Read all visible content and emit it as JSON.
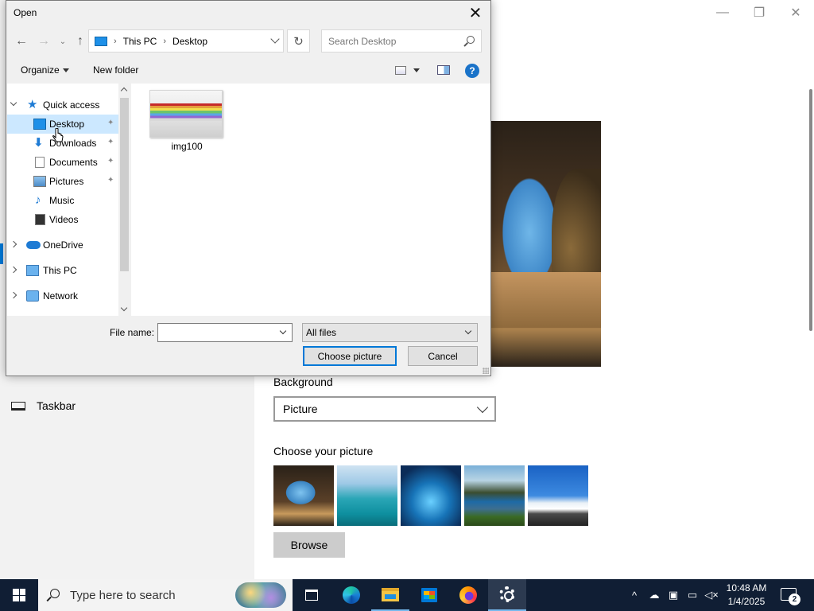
{
  "settings": {
    "window_controls": {
      "minimize": "—",
      "maximize": "❐",
      "close": "✕"
    },
    "nav_taskbar_label": "Taskbar",
    "background_label": "Background",
    "background_value": "Picture",
    "choose_picture_label": "Choose your picture",
    "browse_label": "Browse"
  },
  "dialog": {
    "title": "Open",
    "close_glyph": "✕",
    "nav": {
      "back": "←",
      "forward": "→",
      "recent": "⌄",
      "up": "↑",
      "refresh": "↻"
    },
    "breadcrumb": [
      "This PC",
      "Desktop"
    ],
    "breadcrumb_sep": "›",
    "search_placeholder": "Search Desktop",
    "toolbar": {
      "organize": "Organize",
      "new_folder": "New folder",
      "help": "?"
    },
    "nav_tree": [
      {
        "label": "Quick access",
        "icon": "star-icon"
      },
      {
        "label": "Desktop",
        "icon": "desktop-icon",
        "pinned": true,
        "selected": true
      },
      {
        "label": "Downloads",
        "icon": "download-icon",
        "pinned": true
      },
      {
        "label": "Documents",
        "icon": "document-icon",
        "pinned": true
      },
      {
        "label": "Pictures",
        "icon": "pictures-icon",
        "pinned": true
      },
      {
        "label": "Music",
        "icon": "music-icon"
      },
      {
        "label": "Videos",
        "icon": "video-icon"
      },
      {
        "label": "OneDrive",
        "icon": "cloud-icon"
      },
      {
        "label": "This PC",
        "icon": "computer-icon"
      },
      {
        "label": "Network",
        "icon": "network-icon"
      }
    ],
    "pin_glyph": "📌",
    "files": [
      {
        "name": "img100",
        "type": "image"
      }
    ],
    "file_name_label": "File name:",
    "file_name_value": "",
    "file_type_value": "All files",
    "choose_button": "Choose picture",
    "cancel_button": "Cancel"
  },
  "taskbar": {
    "search_placeholder": "Type here to search",
    "apps": [
      "task-view",
      "edge",
      "file-explorer",
      "store",
      "firefox",
      "settings"
    ],
    "clock_time": "10:48 AM",
    "clock_date": "1/4/2025",
    "tray_chevron": "^",
    "notification_count": "2"
  },
  "colors": {
    "accent": "#0078d7",
    "taskbar": "#101e34",
    "selected": "#cce8ff"
  }
}
